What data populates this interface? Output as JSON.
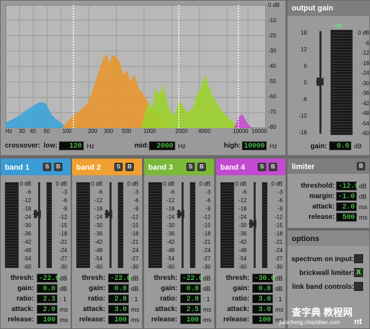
{
  "spectrum": {
    "db_labels": [
      "0 dB",
      "-10",
      "-20",
      "-30",
      "-40",
      "-50",
      "-60",
      "-70",
      "-80"
    ],
    "freq_labels": [
      "Hz",
      "30",
      "40",
      "60",
      "100",
      "200",
      "300",
      "500",
      "1000",
      "2000",
      "4000",
      "10000",
      "16000"
    ],
    "band_colors": [
      "#3aa3d8",
      "#e8952e",
      "#9bd32a",
      "#c84ad0"
    ]
  },
  "crossover": {
    "label": "crossover:",
    "low_label": "low:",
    "low_value": "120",
    "low_unit": "Hz",
    "mid_label": "mid:",
    "mid_value": "2000",
    "mid_unit": "Hz",
    "high_label": "high:",
    "high_value": "10000",
    "high_unit": "Hz"
  },
  "bands": [
    {
      "title": "band 1",
      "color": "#3a9bd5",
      "thresh": "-22.0",
      "gain": "0.0",
      "ratio": "2.3",
      "attack": "2.0",
      "release": "100"
    },
    {
      "title": "band 2",
      "color": "#f0a030",
      "thresh": "-22.0",
      "gain": "0.0",
      "ratio": "2.8",
      "attack": "3.0",
      "release": "100"
    },
    {
      "title": "band 3",
      "color": "#7ab83a",
      "thresh": "-22.0",
      "gain": "0.0",
      "ratio": "2.8",
      "attack": "2.5",
      "release": "100"
    },
    {
      "title": "band 4",
      "color": "#c24ad0",
      "thresh": "-30.0",
      "gain": "0.0",
      "ratio": "3.0",
      "attack": "3.0",
      "release": "100"
    }
  ],
  "band_labels": {
    "thresh": "thresh:",
    "gain": "gain:",
    "ratio": "ratio:",
    "attack": "attack:",
    "release": "release:",
    "unit_db": "dB",
    "unit_ratio": ": 1",
    "unit_ms": "ms"
  },
  "band_scale_left": [
    "0 dB",
    "-6",
    "-12",
    "-18",
    "-24",
    "-30",
    "-36",
    "-42",
    "-48",
    "-54",
    "-60"
  ],
  "band_scale_right": [
    "0 dB",
    "-3",
    "-6",
    "-9",
    "-12",
    "-15",
    "-18",
    "-21",
    "-24",
    "-27",
    "-30"
  ],
  "output": {
    "title": "output gain",
    "inf_label": "-inf",
    "left_scale": [
      "18",
      "12",
      "6",
      "0",
      "-6",
      "-12",
      "-18"
    ],
    "right_scale": [
      "0 dB",
      "-6",
      "-12",
      "-18",
      "-24",
      "-30",
      "-36",
      "-42",
      "-48",
      "-54",
      "-60"
    ],
    "gain_label": "gain:",
    "gain_value": "0.0",
    "gain_unit": "dB"
  },
  "limiter": {
    "title": "limiter",
    "threshold_label": "threshold:",
    "threshold_value": "-12.0",
    "threshold_unit": "dB",
    "margin_label": "margin:",
    "margin_value": "-1.0",
    "margin_unit": "dB",
    "attack_label": "attack:",
    "attack_value": "2.0",
    "attack_unit": "ms",
    "release_label": "release:",
    "release_value": "500",
    "release_unit": "ms"
  },
  "options": {
    "title": "options",
    "spectrum_label": "spectrum on input:",
    "spectrum_checked": "",
    "brickwall_label": "brickwall limiter:",
    "brickwall_checked": "X",
    "link_label": "link band controls:",
    "link_checked": ""
  },
  "solo_label": "S",
  "bypass_label": "B",
  "watermark": {
    "title": "查字典 教程网",
    "url": "jiaocheng.chazidian.com",
    "tail": "nt"
  }
}
